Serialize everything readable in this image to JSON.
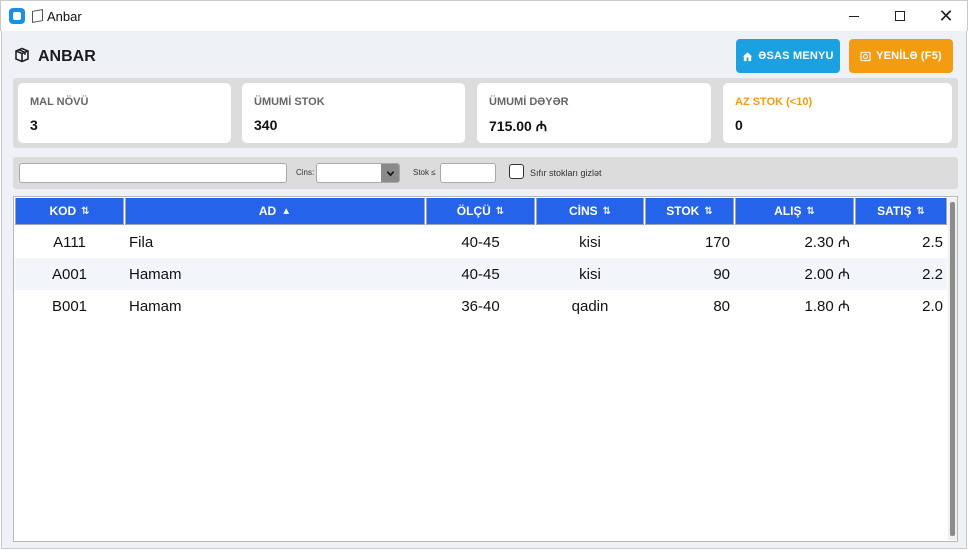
{
  "window": {
    "title": "Anbar"
  },
  "header": {
    "title": "ANBAR",
    "menu_button": "ƏSAS MENYU",
    "refresh_button": "YENİLƏ (F5)"
  },
  "summary": {
    "cards": [
      {
        "label": "MAL NÖVÜ",
        "value": "3"
      },
      {
        "label": "ÜMUMİ STOK",
        "value": "340"
      },
      {
        "label": "ÜMUMİ DƏYƏR",
        "value": "715.00 ₼"
      },
      {
        "label": "AZ STOK (<10)",
        "value": "0"
      }
    ],
    "warn_color": "#f39c12"
  },
  "filters": {
    "search_value": "",
    "cins_label": "Cins:",
    "cins_selected": "",
    "stock_label": "Stok ≤",
    "stock_value": "",
    "hide_zero_label": "Sıfır stokları gizlət",
    "hide_zero_checked": false
  },
  "table": {
    "columns": [
      {
        "label": "KOD",
        "sort": "⇅"
      },
      {
        "label": "AD",
        "sort": "▲"
      },
      {
        "label": "ÖLÇÜ",
        "sort": "⇅"
      },
      {
        "label": "CİNS",
        "sort": "⇅"
      },
      {
        "label": "STOK",
        "sort": "⇅"
      },
      {
        "label": "ALIŞ",
        "sort": "⇅"
      },
      {
        "label": "SATIŞ",
        "sort": "⇅"
      }
    ],
    "rows": [
      {
        "kod": "A111",
        "ad": "Fila",
        "olcu": "40-45",
        "cins": "kisi",
        "stok": "170",
        "alis": "2.30 ₼",
        "satis": "2.5"
      },
      {
        "kod": "A001",
        "ad": "Hamam",
        "olcu": "40-45",
        "cins": "kisi",
        "stok": "90",
        "alis": "2.00 ₼",
        "satis": "2.2"
      },
      {
        "kod": "B001",
        "ad": "Hamam",
        "olcu": "36-40",
        "cins": "qadin",
        "stok": "80",
        "alis": "1.80 ₼",
        "satis": "2.0"
      }
    ],
    "header_color": "#2563eb"
  },
  "colors": {
    "menu_button": "#1ba1e2",
    "refresh_button": "#f39c12"
  }
}
